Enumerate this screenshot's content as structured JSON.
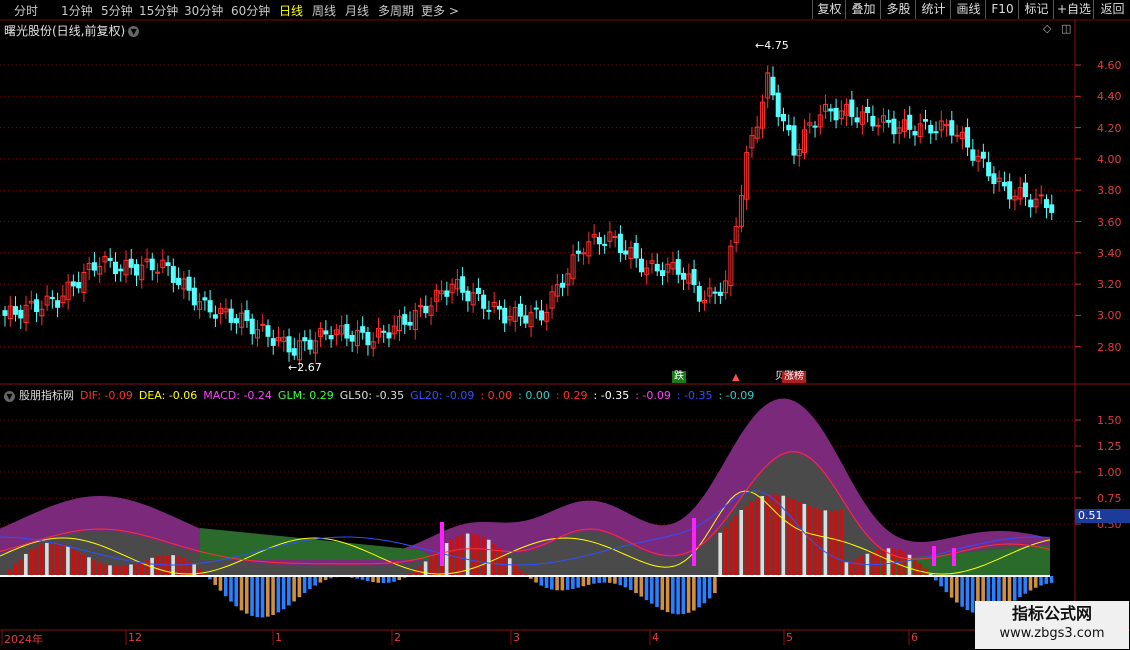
{
  "periods": [
    "分时",
    "1分钟",
    "5分钟",
    "15分钟",
    "30分钟",
    "60分钟",
    "日线",
    "周线",
    "月线",
    "多周期",
    "更多 >"
  ],
  "active_period": "日线",
  "toolbar": [
    "复权",
    "叠加",
    "多股",
    "统计",
    "画线",
    "F10",
    "标记",
    "+自选",
    "返回"
  ],
  "stock_title": "曙光股份(日线,前复权)",
  "price_axis": [
    "4.60",
    "4.40",
    "4.20",
    "4.00",
    "3.80",
    "3.60",
    "3.40",
    "3.20",
    "3.00",
    "2.80"
  ],
  "high_label": "4.75",
  "low_label": "2.67",
  "badges": {
    "down": "跌",
    "zhang": "涨榜",
    "prefix": "贝"
  },
  "indicator": {
    "name": "股朋指标网",
    "items": [
      {
        "label": "DIF: -0.09",
        "color": "#ff3030"
      },
      {
        "label": "DEA: -0.06",
        "color": "#ffff00"
      },
      {
        "label": "MACD: -0.24",
        "color": "#ff40ff"
      },
      {
        "label": "GLM: 0.29",
        "color": "#40ff40"
      },
      {
        "label": "GL50: -0.35",
        "color": "#dddddd"
      },
      {
        "label": "GL20: -0.09",
        "color": "#3050ff"
      },
      {
        "label": ": 0.00",
        "color": "#ff3030"
      },
      {
        "label": ": 0.00",
        "color": "#30d0d0"
      },
      {
        "label": ": 0.29",
        "color": "#ff3030"
      },
      {
        "label": ": -0.35",
        "color": "#ffffff"
      },
      {
        "label": ": -0.09",
        "color": "#ff40ff"
      },
      {
        "label": ": -0.35",
        "color": "#3050ff"
      },
      {
        "label": ": -0.09",
        "color": "#30d0d0"
      }
    ]
  },
  "ind_axis": [
    "1.50",
    "1.25",
    "1.00",
    "0.75",
    "0.50"
  ],
  "current_value": "0.51",
  "time_axis": [
    {
      "label": "2024年"
    },
    {
      "label": "12"
    },
    {
      "label": "1"
    },
    {
      "label": "2"
    },
    {
      "label": "3"
    },
    {
      "label": "4"
    },
    {
      "label": "5"
    },
    {
      "label": "6"
    }
  ],
  "watermark": {
    "main": "指标公式网",
    "sub": "www.zbgs3.com"
  },
  "colors": {
    "up": "#ff3030",
    "down": "#54ffff",
    "grid": "#7a0000"
  }
}
